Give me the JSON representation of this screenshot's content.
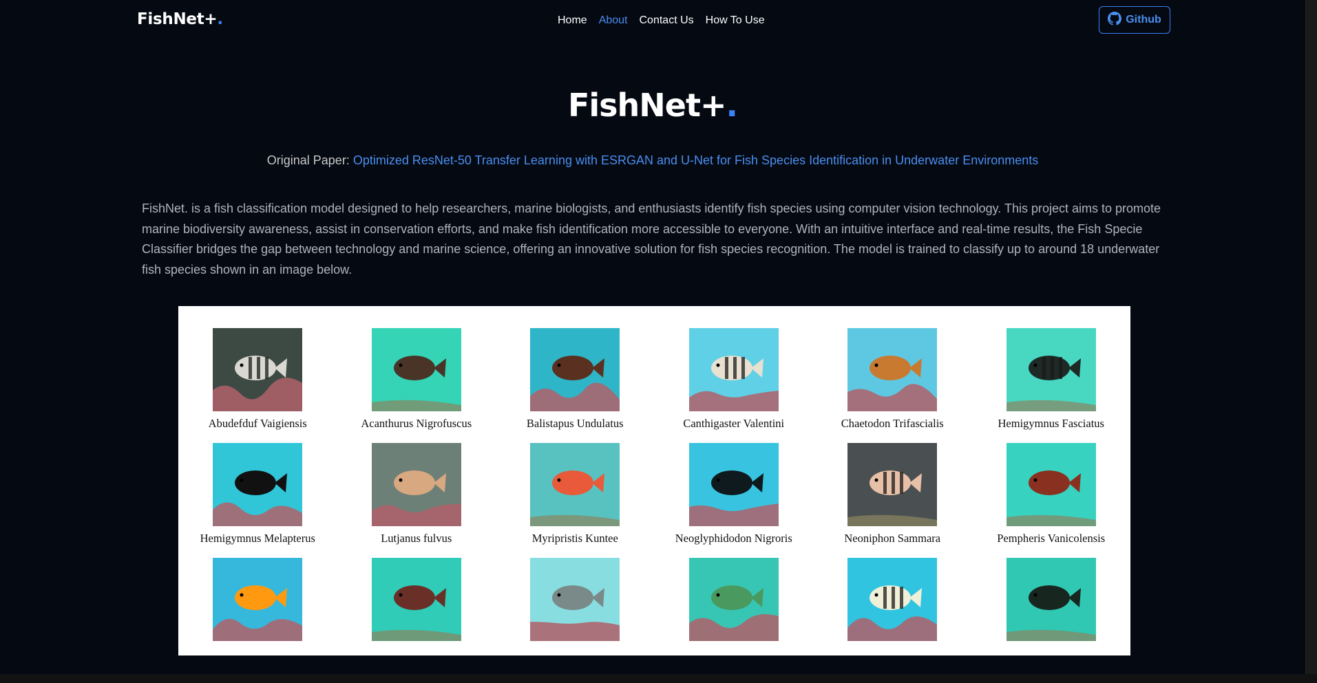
{
  "brand": {
    "name": "FishNet+",
    "dot": "."
  },
  "nav": {
    "items": [
      {
        "label": "Home",
        "active": false
      },
      {
        "label": "About",
        "active": true
      },
      {
        "label": "Contact Us",
        "active": false
      },
      {
        "label": "How To Use",
        "active": false
      }
    ],
    "github_label": "Github"
  },
  "hero": {
    "title": "FishNet+",
    "dot": "."
  },
  "paper": {
    "prefix": "Original Paper: ",
    "link_text": "Optimized ResNet-50 Transfer Learning with ESRGAN and U-Net for Fish Species Identification in Underwater Environments"
  },
  "description": "FishNet. is a fish classification model designed to help researchers, marine biologists, and enthusiasts identify fish species using computer vision technology. This project aims to promote marine biodiversity awareness, assist in conservation efforts, and make fish identification more accessible to everyone. With an intuitive interface and real-time results, the Fish Specie Classifier bridges the gap between technology and marine science, offering an innovative solution for fish species recognition. The model is trained to classify up to around 18 underwater fish species shown in an image below.",
  "species": [
    {
      "name": "Abudefduf Vaigiensis",
      "water": "#3d4a44",
      "fish": "#d8d8d0",
      "stripe": true,
      "coral": true
    },
    {
      "name": "Acanthurus Nigrofuscus",
      "water": "#35d4b6",
      "fish": "#4a3428",
      "stripe": false,
      "coral": false
    },
    {
      "name": "Balistapus Undulatus",
      "water": "#2fb5c8",
      "fish": "#5a3020",
      "stripe": false,
      "coral": true
    },
    {
      "name": "Canthigaster Valentini",
      "water": "#5fd0e6",
      "fish": "#e8e0d0",
      "stripe": true,
      "coral": true
    },
    {
      "name": "Chaetodon Trifascialis",
      "water": "#5ec8e2",
      "fish": "#c87a30",
      "stripe": false,
      "coral": true
    },
    {
      "name": "Hemigymnus Fasciatus",
      "water": "#48d8c2",
      "fish": "#1e2a26",
      "stripe": true,
      "coral": false
    },
    {
      "name": "Hemigymnus Melapterus",
      "water": "#30c6d8",
      "fish": "#111111",
      "stripe": false,
      "coral": true
    },
    {
      "name": "Lutjanus fulvus",
      "water": "#6d8077",
      "fish": "#d8a880",
      "stripe": false,
      "coral": true
    },
    {
      "name": "Myripristis Kuntee",
      "water": "#58c2c0",
      "fish": "#e85a3a",
      "stripe": false,
      "coral": false
    },
    {
      "name": "Neoglyphidodon Nigroris",
      "water": "#38c4e0",
      "fish": "#0e1a1e",
      "stripe": false,
      "coral": true
    },
    {
      "name": "Neoniphon Sammara",
      "water": "#4a5052",
      "fish": "#e8c0a8",
      "stripe": true,
      "coral": false
    },
    {
      "name": "Pempheris Vanicolensis",
      "water": "#38d2c0",
      "fish": "#8a3020",
      "stripe": false,
      "coral": false
    },
    {
      "name": "",
      "water": "#36b8dc",
      "fish": "#ff9a10",
      "stripe": false,
      "coral": true
    },
    {
      "name": "",
      "water": "#30ccb8",
      "fish": "#6a3028",
      "stripe": false,
      "coral": false
    },
    {
      "name": "",
      "water": "#88dde0",
      "fish": "#7a8a88",
      "stripe": false,
      "coral": true
    },
    {
      "name": "",
      "water": "#38c6b4",
      "fish": "#4a9a60",
      "stripe": false,
      "coral": true
    },
    {
      "name": "",
      "water": "#30c4e0",
      "fish": "#f0f0d8",
      "stripe": true,
      "coral": true
    },
    {
      "name": "",
      "water": "#30c8b2",
      "fish": "#182620",
      "stripe": false,
      "coral": false
    }
  ],
  "colors": {
    "background": "#050912",
    "accent": "#3b82f6",
    "link": "#4a8ff0"
  }
}
